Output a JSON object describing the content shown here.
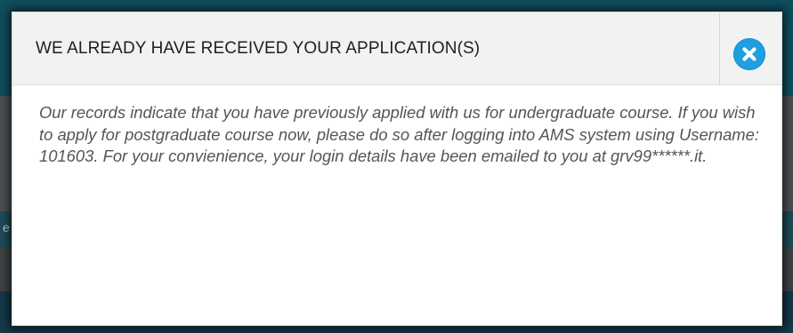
{
  "modal": {
    "title": "WE ALREADY HAVE RECEIVED YOUR APPLICATION(S)",
    "message": "Our records indicate that you have previously applied with us for undergraduate course. If you wish to apply for postgraduate course now, please do so after logging into AMS system using Username: 101603. For your convienience, your login details have been emailed to you at grv99******.it.",
    "close_icon": "close-icon"
  },
  "backdrop": {
    "partial_text": "e"
  },
  "colors": {
    "accent": "#1f9fe0",
    "header_bg": "#f2f2f2",
    "body_text": "#555555"
  }
}
